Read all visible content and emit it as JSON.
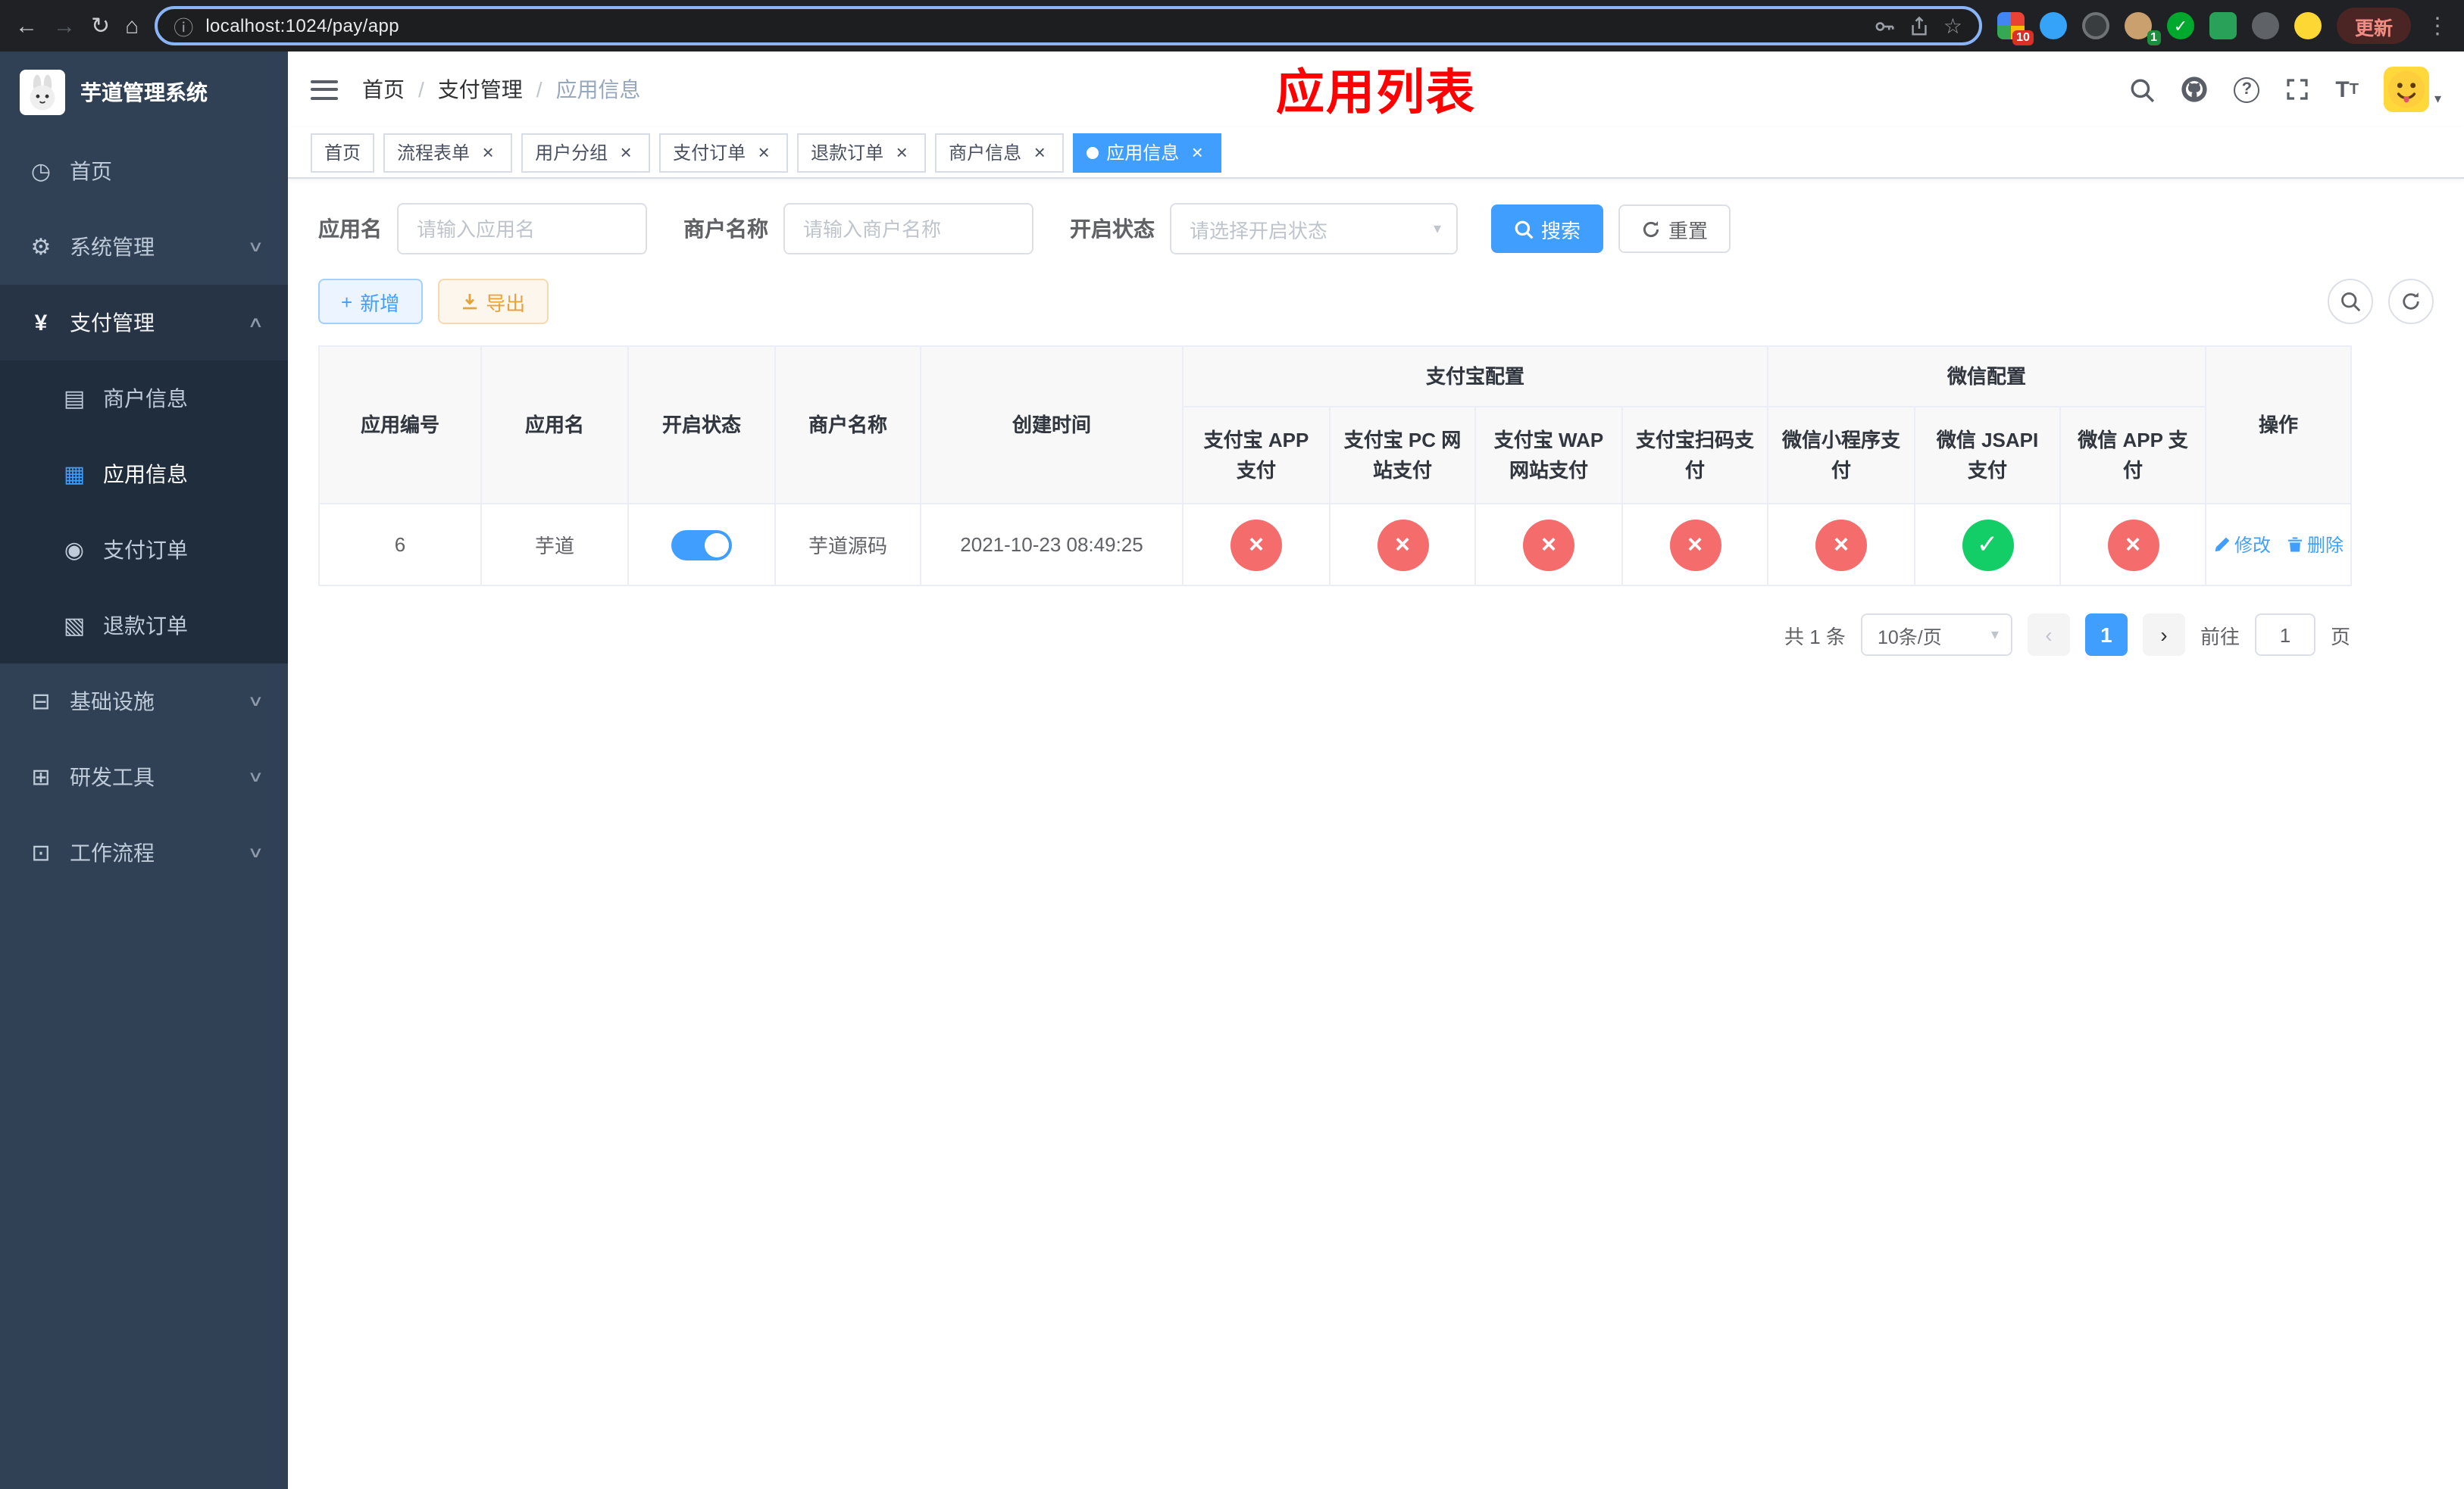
{
  "theme": {
    "accent": "#409eff",
    "success": "#13ce66",
    "danger": "#f56c6c",
    "warning": "#e6a23c",
    "title_red": "#ff0000",
    "sidebar_bg": "#304156",
    "submenu_bg": "#1f2d3d"
  },
  "browser": {
    "url": "localhost:1024/pay/app",
    "update_label": "更新",
    "ext_badge_1": "10",
    "ext_badge_2": "1"
  },
  "icons": {
    "back": "←",
    "forward": "→",
    "reload": "↻",
    "home": "⌂",
    "info": "ⓘ",
    "star": "☆",
    "kebab": "⋮",
    "dashboard": "◷",
    "gear": "⚙",
    "yen": "¥",
    "merchant": "▤",
    "app": "▦",
    "order": "◉",
    "refund": "▧",
    "infra": "⊟",
    "devtool": "⊞",
    "workflow": "⊡",
    "chev_down": "∨",
    "chev_up": "∧",
    "help": "?",
    "font_size": "T",
    "caret_down": "▾",
    "plus": "+",
    "prev": "‹",
    "next": "›",
    "close": "×",
    "check": "✓",
    "cross": "×"
  },
  "sidebar": {
    "logo_title": "芋道管理系统",
    "items": [
      {
        "label": "首页"
      },
      {
        "label": "系统管理"
      },
      {
        "label": "支付管理"
      },
      {
        "label": "商户信息"
      },
      {
        "label": "应用信息"
      },
      {
        "label": "支付订单"
      },
      {
        "label": "退款订单"
      },
      {
        "label": "基础设施"
      },
      {
        "label": "研发工具"
      },
      {
        "label": "工作流程"
      }
    ]
  },
  "header": {
    "breadcrumb": [
      "首页",
      "支付管理",
      "应用信息"
    ],
    "page_title": "应用列表"
  },
  "tabs": [
    {
      "label": "首页"
    },
    {
      "label": "流程表单"
    },
    {
      "label": "用户分组"
    },
    {
      "label": "支付订单"
    },
    {
      "label": "退款订单"
    },
    {
      "label": "商户信息"
    },
    {
      "label": "应用信息"
    }
  ],
  "filters": {
    "app_name_label": "应用名",
    "app_name_placeholder": "请输入应用名",
    "merchant_label": "商户名称",
    "merchant_placeholder": "请输入商户名称",
    "status_label": "开启状态",
    "status_placeholder": "请选择开启状态",
    "search_label": "搜索",
    "reset_label": "重置"
  },
  "toolbar": {
    "add_label": "新增",
    "export_label": "导出"
  },
  "table": {
    "groups": {
      "alipay": "支付宝配置",
      "wechat": "微信配置"
    },
    "columns": [
      "应用编号",
      "应用名",
      "开启状态",
      "商户名称",
      "创建时间",
      "支付宝 APP 支付",
      "支付宝 PC 网站支付",
      "支付宝 WAP 网站支付",
      "支付宝扫码支付",
      "微信小程序支付",
      "微信 JSAPI 支付",
      "微信 APP 支付",
      "操作"
    ],
    "row": {
      "id": "6",
      "name": "芋道",
      "enabled": true,
      "merchant": "芋道源码",
      "created": "2021-10-23 08:49:25",
      "configs": [
        false,
        false,
        false,
        false,
        false,
        true,
        false
      ],
      "edit_label": "修改",
      "delete_label": "删除"
    }
  },
  "pagination": {
    "total_text": "共 1 条",
    "page_size_label": "10条/页",
    "current_page": "1",
    "goto_prefix": "前往",
    "goto_value": "1",
    "goto_suffix": "页"
  }
}
